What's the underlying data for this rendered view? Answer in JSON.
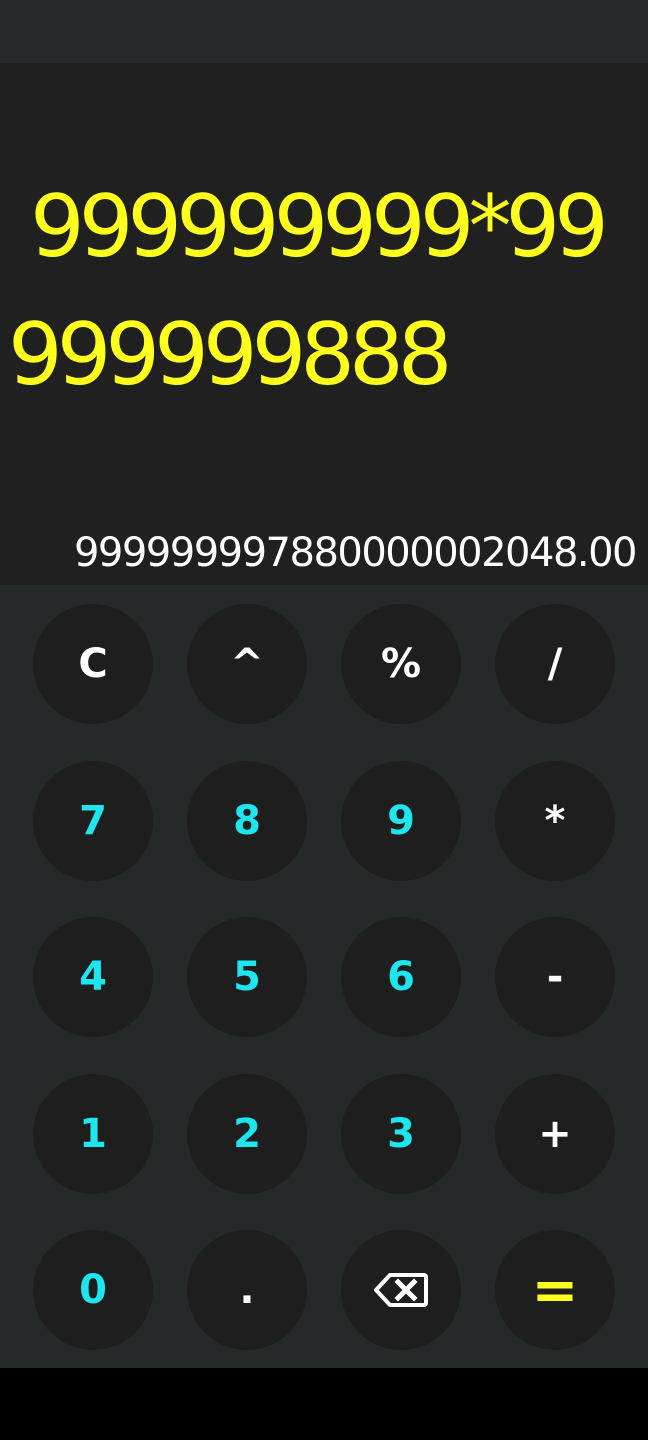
{
  "display": {
    "expression_line1": "999999999*99",
    "expression_line2": "999999888",
    "result": "999999997880000002048.00"
  },
  "keys": {
    "clear": "C",
    "power": "^",
    "percent": "%",
    "divide": "/",
    "seven": "7",
    "eight": "8",
    "nine": "9",
    "multiply": "*",
    "four": "4",
    "five": "5",
    "six": "6",
    "subtract": "-",
    "one": "1",
    "two": "2",
    "three": "3",
    "add": "+",
    "zero": "0",
    "decimal": ".",
    "backspace_icon": "backspace-icon",
    "equals": "="
  },
  "colors": {
    "expression": "#ffff1e",
    "result": "#ffffff",
    "digit_keys": "#1ee6ef",
    "operator_keys": "#ffffff",
    "equals_key": "#ffff1e",
    "key_background": "#1e1e1e",
    "keypad_background": "#232a29",
    "display_background": "#202020"
  }
}
